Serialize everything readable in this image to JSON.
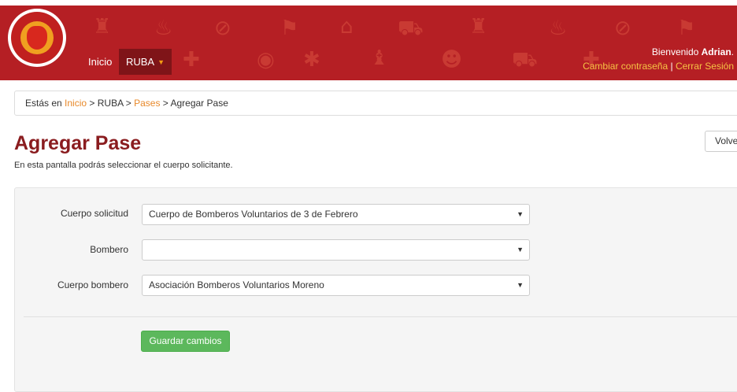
{
  "header": {
    "nav": {
      "inicio": "Inicio",
      "ruba": "RUBA"
    },
    "welcome_prefix": "Bienvenido ",
    "user_name": "Adrian",
    "welcome_suffix": ".",
    "change_password": "Cambiar contraseña",
    "separator": "|",
    "logout": "Cerrar Sesión",
    "background_icons": [
      "hydrant",
      "siren",
      "no-fire",
      "flag",
      "fire-building",
      "fire-truck",
      "hydrant",
      "siren",
      "no-fire",
      "flag",
      "first-aid",
      "alarm",
      "hose",
      "extinguisher",
      "helmet",
      "tanker",
      "first-aid"
    ]
  },
  "breadcrumb": {
    "prefix": "Estás en ",
    "inicio": "Inicio",
    "sep1": " > ",
    "ruba": "RUBA",
    "sep2": " > ",
    "pases": "Pases",
    "sep3": " > ",
    "current": "Agregar Pase"
  },
  "page": {
    "title": "Agregar Pase",
    "subtitle": "En esta pantalla podrás seleccionar el cuerpo solicitante.",
    "back_button": "Volver"
  },
  "form": {
    "cuerpo_solicitud": {
      "label": "Cuerpo solicitud",
      "value": "Cuerpo de Bomberos Voluntarios de 3 de Febrero"
    },
    "bombero": {
      "label": "Bombero",
      "value": ""
    },
    "cuerpo_bombero": {
      "label": "Cuerpo bombero",
      "value": "Asociación Bomberos Voluntarios Moreno"
    },
    "save_button": "Guardar cambios"
  },
  "colors": {
    "header": "#b51f24",
    "title": "#8a1c1f",
    "link": "#e8892a",
    "save": "#5cb85c"
  }
}
